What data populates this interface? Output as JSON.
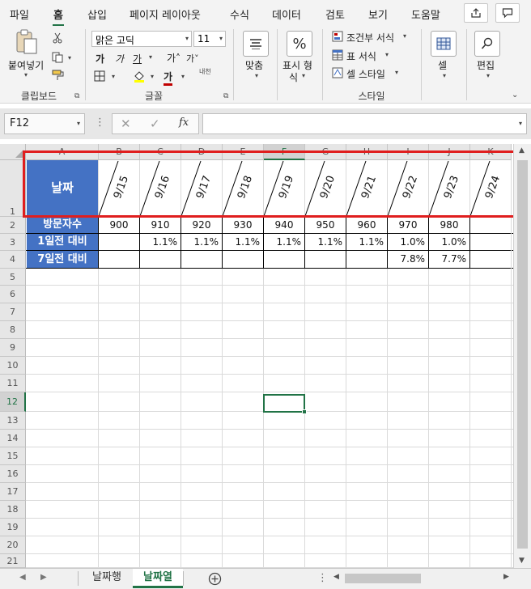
{
  "ribbon_tabs": [
    "파일",
    "홈",
    "삽입",
    "페이지 레이아웃",
    "수식",
    "데이터",
    "검토",
    "보기",
    "도움말"
  ],
  "active_tab": "홈",
  "ribbon": {
    "paste_label": "붙여넣기",
    "clipboard_group": "클립보드",
    "font_name": "맑은 고딕",
    "font_size": "11",
    "font_group": "글꼴",
    "bold": "가",
    "italic": "가",
    "underline": "가",
    "grow_font": "가˄",
    "shrink_font": "가˅",
    "font_color_btn": "가",
    "phonetic": "내천",
    "align_label": "맞춤",
    "number_label_1": "표시 형",
    "number_label_2": "식",
    "conditional": "조건부 서식",
    "table_format": "표 서식",
    "cell_style": "셀 스타일",
    "style_group": "스타일",
    "cells_label": "셀",
    "edit_label": "편집"
  },
  "namebox": "F12",
  "fx": "fx",
  "columns": [
    "A",
    "B",
    "C",
    "D",
    "E",
    "F",
    "G",
    "H",
    "I",
    "J",
    "K"
  ],
  "selected_column": "F",
  "rows": [
    "1",
    "2",
    "3",
    "4",
    "5",
    "6",
    "7",
    "8",
    "9",
    "10",
    "11",
    "12",
    "13",
    "14",
    "15",
    "16",
    "17",
    "18",
    "19",
    "20",
    "21"
  ],
  "selected_row": "12",
  "sheet": {
    "header_label": "날짜",
    "dates": [
      "9/15",
      "9/16",
      "9/17",
      "9/18",
      "9/19",
      "9/20",
      "9/21",
      "9/22",
      "9/23",
      "9/24"
    ],
    "row_labels": [
      "방문자수",
      "1일전 대비",
      "7일전 대비"
    ],
    "visitors": [
      "900",
      "910",
      "920",
      "930",
      "940",
      "950",
      "960",
      "970",
      "980",
      ""
    ],
    "day_change": [
      "",
      "1.1%",
      "1.1%",
      "1.1%",
      "1.1%",
      "1.1%",
      "1.1%",
      "1.0%",
      "1.0%",
      ""
    ],
    "week_change": [
      "",
      "",
      "",
      "",
      "",
      "",
      "",
      "7.8%",
      "7.7%",
      ""
    ]
  },
  "sheet_tabs": [
    "날짜행",
    "날짜열"
  ],
  "active_sheet": "날짜열",
  "colors": {
    "accent": "#217346",
    "label_fill": "#4472c4",
    "highlight": "#e01e1e"
  }
}
